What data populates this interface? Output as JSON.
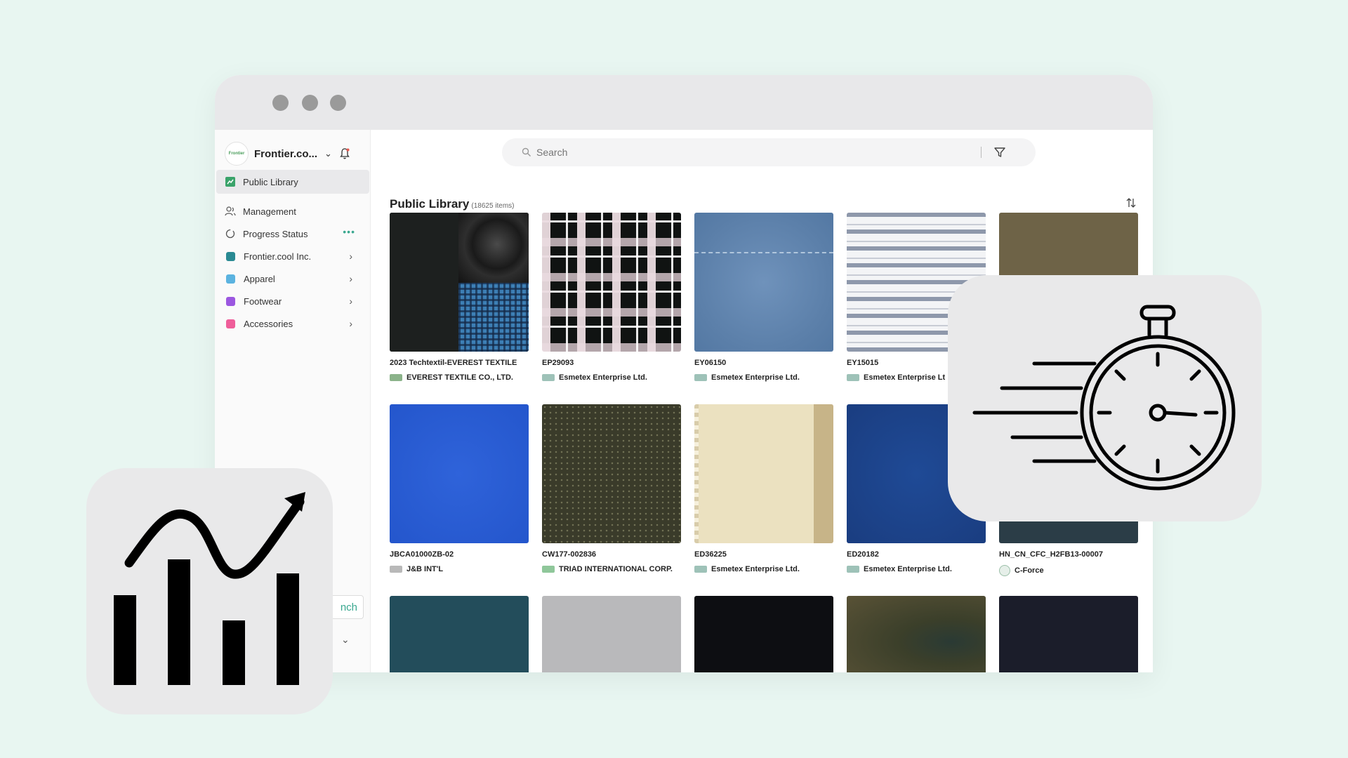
{
  "organization": {
    "name": "Frontier.co...",
    "logo_text": "Frontier"
  },
  "sidebar": {
    "items": [
      {
        "label": "Public Library"
      },
      {
        "label": "Management"
      },
      {
        "label": "Progress Status"
      },
      {
        "label": "Frontier.cool Inc.",
        "color": "#2a8a93"
      },
      {
        "label": "Apparel",
        "color": "#5bb3e0"
      },
      {
        "label": "Footwear",
        "color": "#9b57e0"
      },
      {
        "label": "Accessories",
        "color": "#ef5e9a"
      }
    ],
    "launch_button_partial": "nch"
  },
  "search": {
    "placeholder": "Search"
  },
  "library": {
    "title": "Public Library",
    "count_text": "(18625 items)"
  },
  "materials": [
    {
      "code": "2023 Techtextil-EVEREST TEXTILE",
      "supplier": "EVEREST TEXTILE CO., LTD."
    },
    {
      "code": "EP29093",
      "supplier": "Esmetex Enterprise Ltd."
    },
    {
      "code": "EY06150",
      "supplier": "Esmetex Enterprise Ltd."
    },
    {
      "code": "EY15015",
      "supplier": "Esmetex Enterprise Lt"
    },
    {
      "code": "",
      "supplier": ""
    },
    {
      "code": "JBCA01000ZB-02",
      "supplier": "J&B INT'L"
    },
    {
      "code": "CW177-002836",
      "supplier": "TRIAD INTERNATIONAL CORP."
    },
    {
      "code": "ED36225",
      "supplier": "Esmetex Enterprise Ltd."
    },
    {
      "code": "ED20182",
      "supplier": "Esmetex Enterprise Ltd."
    },
    {
      "code": "HN_CN_CFC_H2FB13-00007",
      "supplier": "C-Force"
    }
  ],
  "colors": {
    "background": "#e8f6f1",
    "accent": "#3aa88f",
    "tile": "#e9e9ea"
  },
  "icons": [
    "bell-icon",
    "search-icon",
    "filter-icon",
    "sort-icon",
    "growth-chart-icon",
    "fast-stopwatch-icon"
  ]
}
